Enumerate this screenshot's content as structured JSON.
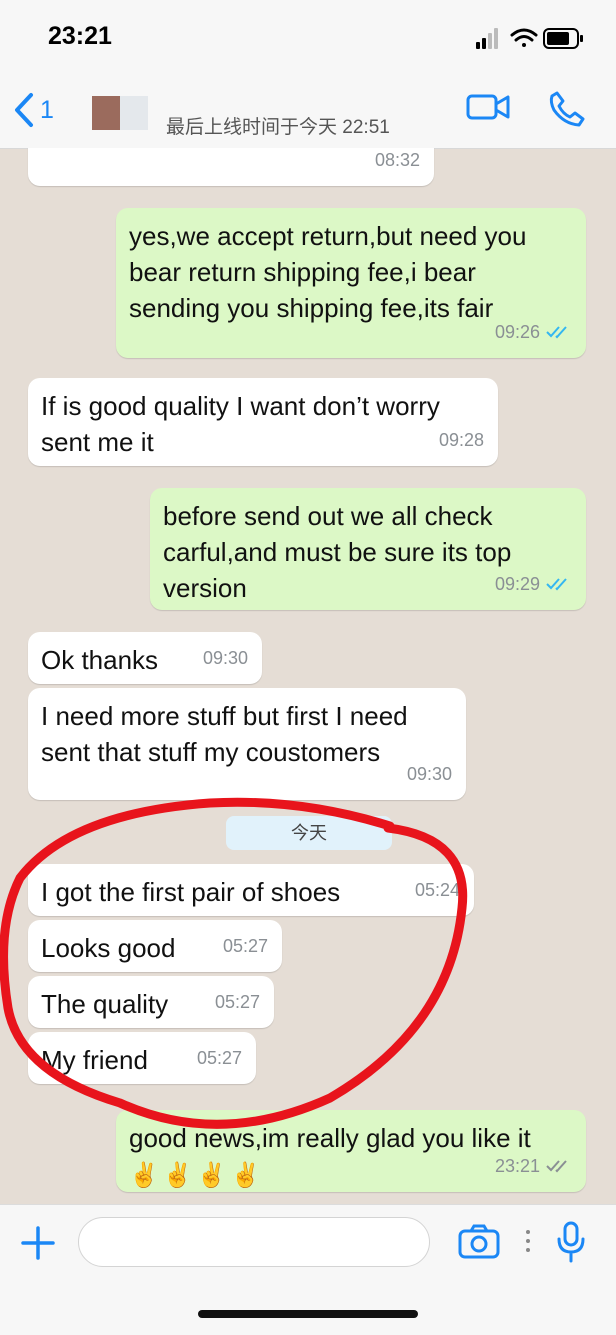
{
  "status_bar": {
    "time": "23:21"
  },
  "header": {
    "back_count": "1",
    "last_seen": "最后上线时间于今天 22:51"
  },
  "messages": [
    {
      "dir": "in",
      "text": "",
      "time": "08:32"
    },
    {
      "dir": "out",
      "text": "yes,we accept return,but need you bear return shipping fee,i bear sending you shipping fee,its fair",
      "time": "09:26",
      "read": true
    },
    {
      "dir": "in",
      "text": "If is good quality I want don’t worry sent me it",
      "time": "09:28"
    },
    {
      "dir": "out",
      "text": "before send out we all check carful,and must be sure its top version",
      "time": "09:29",
      "read": true
    },
    {
      "dir": "in",
      "text": "Ok thanks",
      "time": "09:30"
    },
    {
      "dir": "in",
      "text": "I need more stuff but first I need sent that stuff my coustomers",
      "time": "09:30"
    },
    {
      "dir": "in",
      "text": "I got the first pair of shoes",
      "time": "05:24"
    },
    {
      "dir": "in",
      "text": "Looks good",
      "time": "05:27"
    },
    {
      "dir": "in",
      "text": "The quality",
      "time": "05:27"
    },
    {
      "dir": "in",
      "text": "My friend",
      "time": "05:27"
    },
    {
      "dir": "out",
      "text": "good news,im really glad you like it",
      "emoji": "✌️✌️✌️✌️",
      "time": "23:21",
      "read": true
    }
  ],
  "date_divider": "今天",
  "colors": {
    "accent": "#1b87f5",
    "outgoing_bubble": "#dcf8c6",
    "incoming_bubble": "#ffffff",
    "chat_background": "#e5ddd5",
    "annotation_circle": "#e8141c",
    "read_ticks": "#34b7f1"
  },
  "icons": [
    "chevron-left-icon",
    "video-call-icon",
    "phone-icon",
    "plus-icon",
    "camera-icon",
    "more-dots-icon",
    "microphone-icon",
    "signal-icon",
    "wifi-icon",
    "battery-icon"
  ]
}
